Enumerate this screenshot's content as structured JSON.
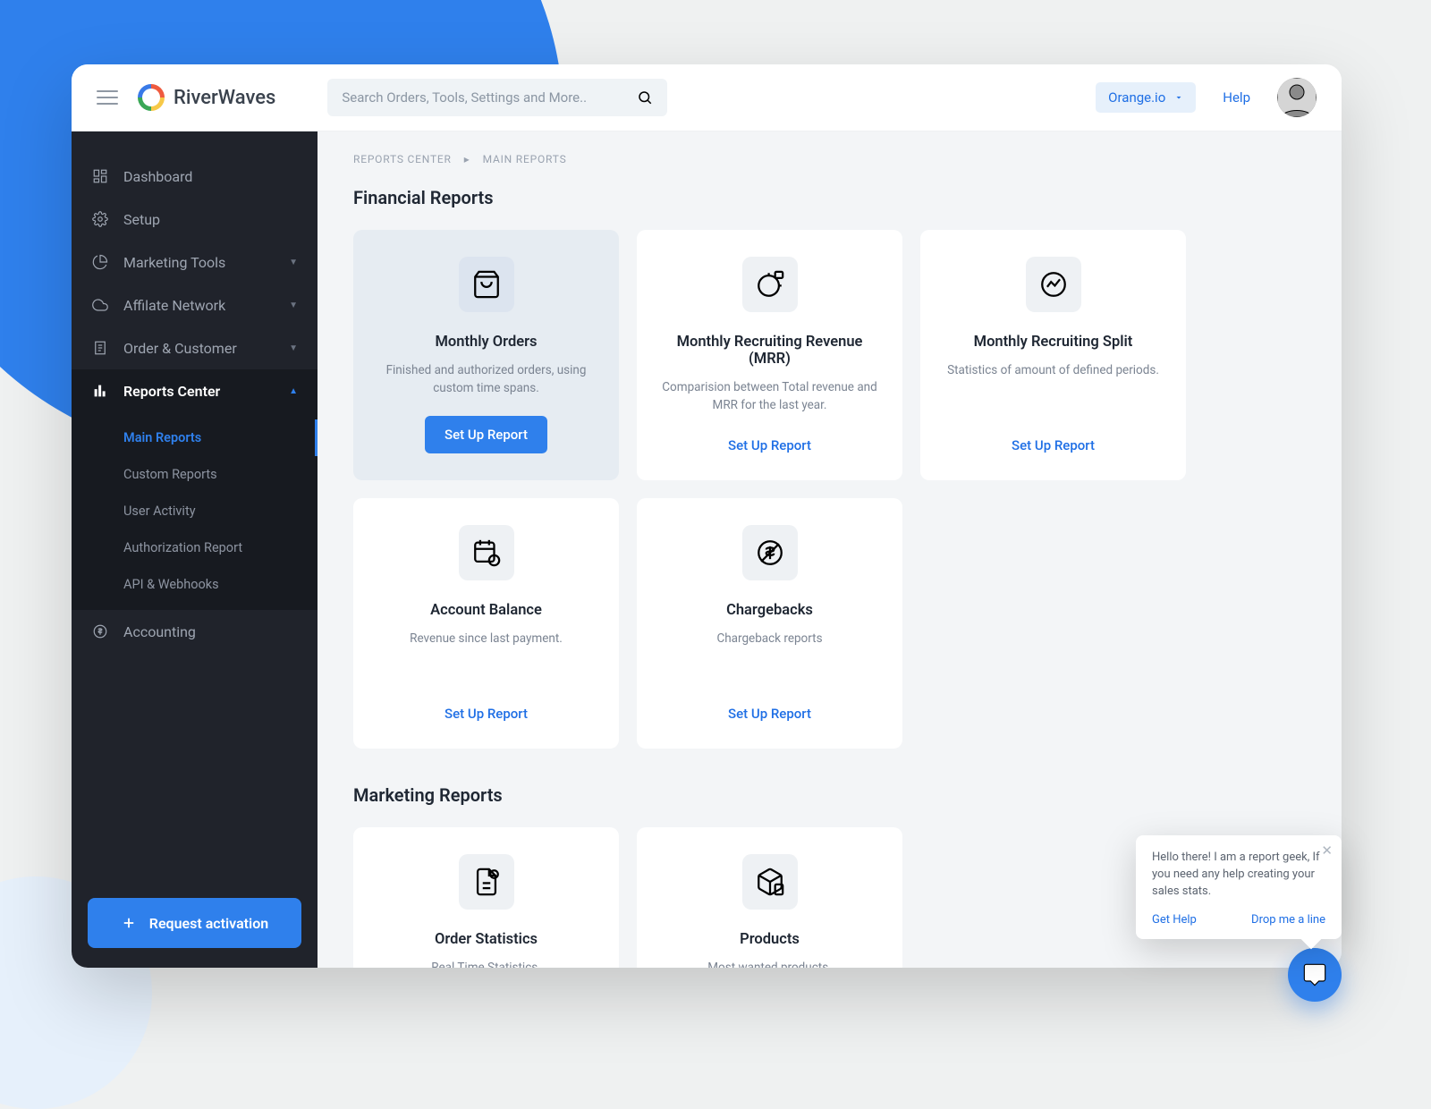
{
  "topbar": {
    "brand": "RiverWaves",
    "search_placeholder": "Search Orders, Tools, Settings and More..",
    "org_label": "Orange.io",
    "help_label": "Help"
  },
  "sidebar": {
    "items": [
      {
        "label": "Dashboard"
      },
      {
        "label": "Setup"
      },
      {
        "label": "Marketing Tools"
      },
      {
        "label": "Affilate Network"
      },
      {
        "label": "Order & Customer"
      },
      {
        "label": "Reports Center"
      },
      {
        "label": "Accounting"
      }
    ],
    "sub_items": [
      {
        "label": "Main Reports"
      },
      {
        "label": "Custom Reports"
      },
      {
        "label": "User Activity"
      },
      {
        "label": "Authorization Report"
      },
      {
        "label": "API & Webhooks"
      }
    ],
    "cta_label": "Request activation"
  },
  "crumbs": {
    "root": "REPORTS CENTER",
    "current": "MAIN REPORTS"
  },
  "sections": {
    "financial_title": "Financial Reports",
    "marketing_title": "Marketing Reports"
  },
  "financial_cards": [
    {
      "title": "Monthly Orders",
      "desc": "Finished and authorized orders, using custom time spans.",
      "action": "Set Up Report"
    },
    {
      "title": "Monthly Recruiting Revenue (MRR)",
      "desc": "Comparision between Total revenue and MRR for the last year.",
      "action": "Set Up Report"
    },
    {
      "title": "Monthly Recruiting Split",
      "desc": "Statistics of amount of defined periods.",
      "action": "Set Up Report"
    },
    {
      "title": "Account Balance",
      "desc": "Revenue since last payment.",
      "action": "Set Up Report"
    },
    {
      "title": "Chargebacks",
      "desc": "Chargeback reports",
      "action": "Set Up Report"
    }
  ],
  "marketing_cards": [
    {
      "title": "Order Statistics",
      "desc": "Real Time Statistics."
    },
    {
      "title": "Products",
      "desc": "Most wanted products."
    }
  ],
  "chat": {
    "message": "Hello there! I am a report geek, If you need any help creating your sales stats.",
    "get_help": "Get Help",
    "drop_line": "Drop me a line"
  }
}
